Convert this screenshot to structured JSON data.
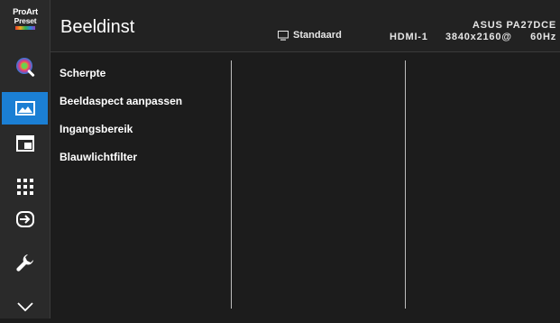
{
  "brand": {
    "line1": "ProArt",
    "line2": "Preset"
  },
  "header": {
    "title": "Beeldinst",
    "preset_label": "Standaard",
    "model": "ASUS PA27DCE",
    "input_source": "HDMI-1",
    "resolution": "3840x2160@",
    "refresh_rate": "60Hz"
  },
  "sidebar": {
    "items": [
      {
        "icon": "proart-preset-icon"
      },
      {
        "icon": "color-icon"
      },
      {
        "icon": "image-icon",
        "active": true
      },
      {
        "icon": "pip-pbp-icon"
      },
      {
        "icon": "qsfp-icon"
      },
      {
        "icon": "input-select-icon"
      },
      {
        "icon": "system-setup-icon"
      },
      {
        "icon": "chevron-down-icon"
      }
    ]
  },
  "menu": {
    "items": [
      "Scherpte",
      "Beeldaspect aanpassen",
      "Ingangsbereik",
      "Blauwlichtfilter"
    ]
  },
  "colors": {
    "background": "#1c1c1c",
    "sidebar": "#2a2a2a",
    "active": "#1b7fd4",
    "text": "#ffffff",
    "divider": "#bdbdbd"
  }
}
